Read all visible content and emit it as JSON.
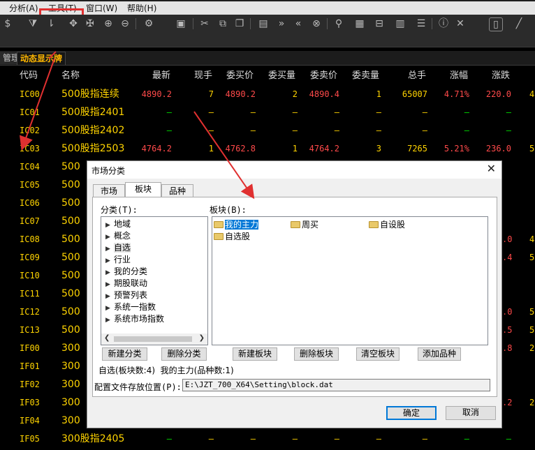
{
  "menu": {
    "items": [
      "分析(A)",
      "工具(T)",
      "窗口(W)",
      "帮助(H)"
    ]
  },
  "tabs": {
    "first": "管理",
    "active": "动态显示牌"
  },
  "table": {
    "headers": [
      "代码",
      "名称",
      "最新",
      "现手",
      "委买价",
      "委买量",
      "委卖价",
      "委卖量",
      "总手",
      "涨幅",
      "涨跌"
    ],
    "rows": [
      {
        "code": "IC00",
        "name": "500股指连续",
        "last": "4890.2",
        "vol": "7",
        "bid": "4890.2",
        "bidv": "2",
        "ask": "4890.4",
        "askv": "1",
        "total": "65007",
        "pct": "4.71%",
        "chg": "220.0",
        "extra": "4"
      },
      {
        "code": "IC01",
        "name": "500股指2401",
        "last": "—",
        "vol": "—",
        "bid": "—",
        "bidv": "—",
        "ask": "—",
        "askv": "—",
        "total": "—",
        "pct": "—",
        "chg": "—",
        "extra": ""
      },
      {
        "code": "IC02",
        "name": "500股指2402",
        "last": "—",
        "vol": "—",
        "bid": "—",
        "bidv": "—",
        "ask": "—",
        "askv": "—",
        "total": "—",
        "pct": "—",
        "chg": "—",
        "extra": ""
      },
      {
        "code": "IC03",
        "name": "500股指2503",
        "last": "4764.2",
        "vol": "1",
        "bid": "4762.8",
        "bidv": "1",
        "ask": "4764.2",
        "askv": "3",
        "total": "7265",
        "pct": "5.21%",
        "chg": "236.0",
        "extra": "5."
      },
      {
        "code": "IC04",
        "name": "500",
        "extra": ""
      },
      {
        "code": "IC05",
        "name": "500",
        "extra": ""
      },
      {
        "code": "IC06",
        "name": "500",
        "extra": ""
      },
      {
        "code": "IC07",
        "name": "500",
        "extra": ""
      },
      {
        "code": "IC08",
        "name": "500",
        "tail": ".0",
        "extra": "4."
      },
      {
        "code": "IC09",
        "name": "500",
        "tail": ".4",
        "extra": "5."
      },
      {
        "code": "IC10",
        "name": "500",
        "extra": ""
      },
      {
        "code": "IC11",
        "name": "500",
        "extra": ""
      },
      {
        "code": "IC12",
        "name": "500",
        "tail": ".0",
        "extra": "5."
      },
      {
        "code": "IC13",
        "name": "500",
        "tail": ".5",
        "extra": "5."
      },
      {
        "code": "IF00",
        "name": "300",
        "tail": ".8",
        "extra": "2."
      },
      {
        "code": "IF01",
        "name": "300",
        "extra": ""
      },
      {
        "code": "IF02",
        "name": "300",
        "extra": ""
      },
      {
        "code": "IF03",
        "name": "300",
        "tail": ".2",
        "extra": "2."
      },
      {
        "code": "IF04",
        "name": "300",
        "extra": ""
      },
      {
        "code": "IF05",
        "name": "300股指2405",
        "last": "—",
        "vol": "—",
        "bid": "—",
        "bidv": "—",
        "ask": "—",
        "askv": "—",
        "total": "—",
        "pct": "—",
        "chg": "—",
        "extra": ""
      }
    ]
  },
  "dialog": {
    "title": "市场分类",
    "close": "✕",
    "tabs": [
      "市场",
      "板块",
      "品种"
    ],
    "category_label": "分类(T):",
    "block_label": "板块(B):",
    "categories": [
      "地域",
      "概念",
      "自选",
      "行业",
      "我的分类",
      "期股联动",
      "预警列表",
      "系统一指数",
      "系统市场指数"
    ],
    "blocks": [
      "我的主力",
      "周买",
      "自设股",
      "自选股"
    ],
    "buttons": {
      "new_category": "新建分类",
      "delete_category": "删除分类",
      "new_block": "新建板块",
      "delete_block": "删除板块",
      "clear_block": "清空板块",
      "add_variety": "添加品种"
    },
    "status": "自选(板块数:4)  我的主力(品种数:1)",
    "config_label": "配置文件存放位置(P):",
    "config_path": "E:\\JZT_700_X64\\Setting\\block.dat",
    "ok": "确定",
    "cancel": "取消"
  },
  "colors": {
    "up": "#ff4a4a",
    "flat": "#ffd400",
    "down": "#00e000",
    "highlight": "#e03030"
  }
}
